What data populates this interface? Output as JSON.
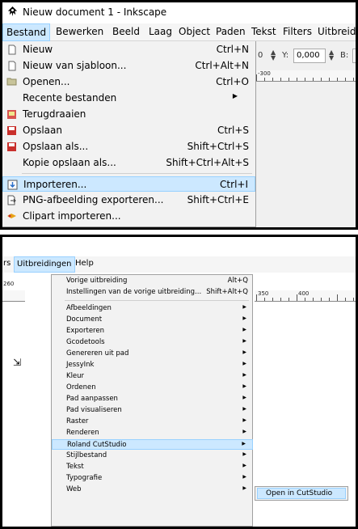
{
  "panel1": {
    "window_title": "Nieuw document 1 - Inkscape",
    "app_icon": "inkscape-logo-icon",
    "menubar": [
      {
        "label": "Bestand",
        "active": true
      },
      {
        "label": "Bewerken"
      },
      {
        "label": "Beeld"
      },
      {
        "label": "Laag"
      },
      {
        "label": "Object"
      },
      {
        "label": "Paden"
      },
      {
        "label": "Tekst"
      },
      {
        "label": "Filters"
      },
      {
        "label": "Uitbreidi"
      }
    ],
    "toolbar": {
      "x_value_partial": "0",
      "y_label": "Y:",
      "y_value": "0,000",
      "b_label": "B:"
    },
    "ruler": {
      "label": "-300"
    },
    "file_menu": [
      {
        "label": "Nieuw",
        "shortcut": "Ctrl+N",
        "icon": "new-document-icon"
      },
      {
        "label": "Nieuw van sjabloon...",
        "shortcut": "Ctrl+Alt+N",
        "icon": "new-from-template-icon"
      },
      {
        "label": "Openen...",
        "shortcut": "Ctrl+O",
        "icon": "folder-open-icon"
      },
      {
        "label": "Recente bestanden",
        "shortcut": "",
        "submenu": true
      },
      {
        "label": "Terugdraaien",
        "shortcut": "",
        "icon": "revert-icon"
      },
      {
        "label": "Opslaan",
        "shortcut": "Ctrl+S",
        "icon": "save-icon"
      },
      {
        "label": "Opslaan als...",
        "shortcut": "Shift+Ctrl+S",
        "icon": "save-as-icon"
      },
      {
        "label": "Kopie opslaan als...",
        "shortcut": "Shift+Ctrl+Alt+S"
      },
      {
        "label": "Importeren...",
        "shortcut": "Ctrl+I",
        "icon": "import-icon",
        "highlighted": true
      },
      {
        "label": "PNG-afbeelding exporteren...",
        "shortcut": "Shift+Ctrl+E",
        "icon": "export-png-icon"
      },
      {
        "label": "Clipart importeren...",
        "shortcut": "",
        "icon": "clipart-icon"
      }
    ]
  },
  "panel2": {
    "menubar": [
      {
        "label": "rs"
      },
      {
        "label": "Uitbreidingen",
        "active": true
      },
      {
        "label": "Help"
      }
    ],
    "left_value": "260",
    "ruler": {
      "label_a": "350",
      "label_b": "400"
    },
    "extensions_menu": [
      {
        "label": "Vorige uitbreiding",
        "shortcut": "Alt+Q"
      },
      {
        "label": "Instellingen van de vorige uitbreiding...",
        "shortcut": "Shift+Alt+Q"
      },
      {
        "label": "Afbeeldingen",
        "submenu": true
      },
      {
        "label": "Document",
        "submenu": true
      },
      {
        "label": "Exporteren",
        "submenu": true
      },
      {
        "label": "Gcodetools",
        "submenu": true
      },
      {
        "label": "Genereren uit pad",
        "submenu": true
      },
      {
        "label": "JessyInk",
        "submenu": true
      },
      {
        "label": "Kleur",
        "submenu": true
      },
      {
        "label": "Ordenen",
        "submenu": true
      },
      {
        "label": "Pad aanpassen",
        "submenu": true
      },
      {
        "label": "Pad visualiseren",
        "submenu": true
      },
      {
        "label": "Raster",
        "submenu": true
      },
      {
        "label": "Renderen",
        "submenu": true
      },
      {
        "label": "Roland CutStudio",
        "submenu": true,
        "highlighted": true
      },
      {
        "label": "Stijlbestand",
        "submenu": true
      },
      {
        "label": "Tekst",
        "submenu": true
      },
      {
        "label": "Typografie",
        "submenu": true
      },
      {
        "label": "Web",
        "submenu": true
      }
    ],
    "submenu": {
      "label": "Open in CutStudio"
    }
  },
  "colors": {
    "highlight": "#cce8ff",
    "highlight_border": "#99d1ff",
    "menu_bg": "#f2f2f2"
  }
}
